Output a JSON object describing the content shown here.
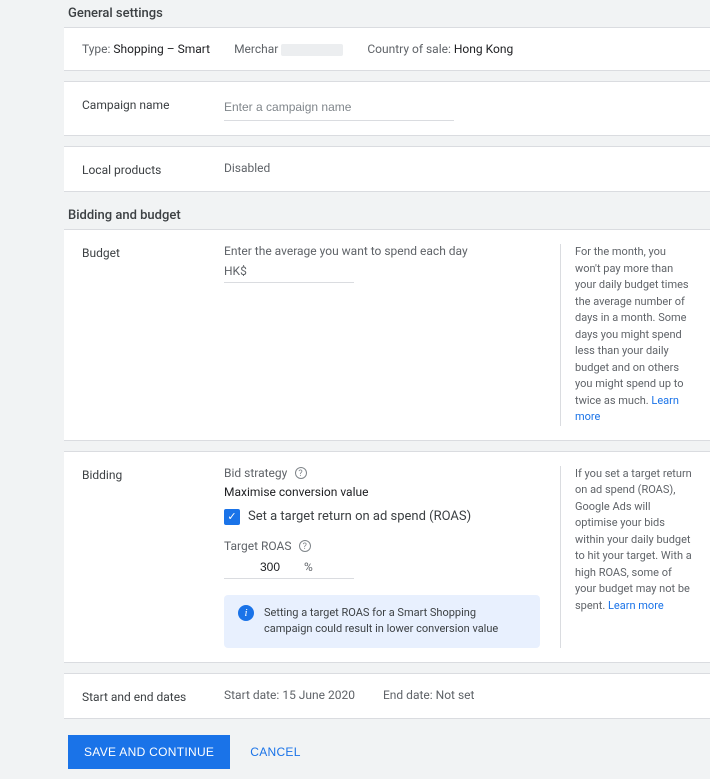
{
  "sections": {
    "general": "General settings",
    "bidding_budget": "Bidding and budget"
  },
  "summary": {
    "type_label": "Type:",
    "type_value": "Shopping – Smart",
    "merchant_label": "Merchar",
    "country_label": "Country of sale:",
    "country_value": "Hong Kong"
  },
  "campaign_name": {
    "label": "Campaign name",
    "placeholder": "Enter a campaign name",
    "value": ""
  },
  "local_products": {
    "label": "Local products",
    "value": "Disabled"
  },
  "budget": {
    "label": "Budget",
    "caption": "Enter the average you want to spend each day",
    "currency": "HK$",
    "value": "",
    "help_text": "For the month, you won't pay more than your daily budget times the average number of days in a month. Some days you might spend less than your daily budget and on others you might spend up to twice as much.",
    "learn_more": "Learn more"
  },
  "bidding": {
    "label": "Bidding",
    "strategy_label": "Bid strategy",
    "strategy_value": "Maximise conversion value",
    "roas_checkbox_label": "Set a target return on ad spend (ROAS)",
    "roas_checked": true,
    "target_roas_label": "Target ROAS",
    "target_roas_value": "300",
    "percent": "%",
    "info_banner": "Setting a target ROAS for a Smart Shopping campaign could result in lower conversion value",
    "help_text": "If you set a target return on ad spend (ROAS), Google Ads will optimise your bids within your daily budget to hit your target. With a high ROAS, some of your budget may not be spent.",
    "learn_more": "Learn more"
  },
  "dates": {
    "label": "Start and end dates",
    "start_label": "Start date:",
    "start_value": "15 June 2020",
    "end_label": "End date:",
    "end_value": "Not set"
  },
  "actions": {
    "save": "SAVE AND CONTINUE",
    "cancel": "CANCEL"
  }
}
